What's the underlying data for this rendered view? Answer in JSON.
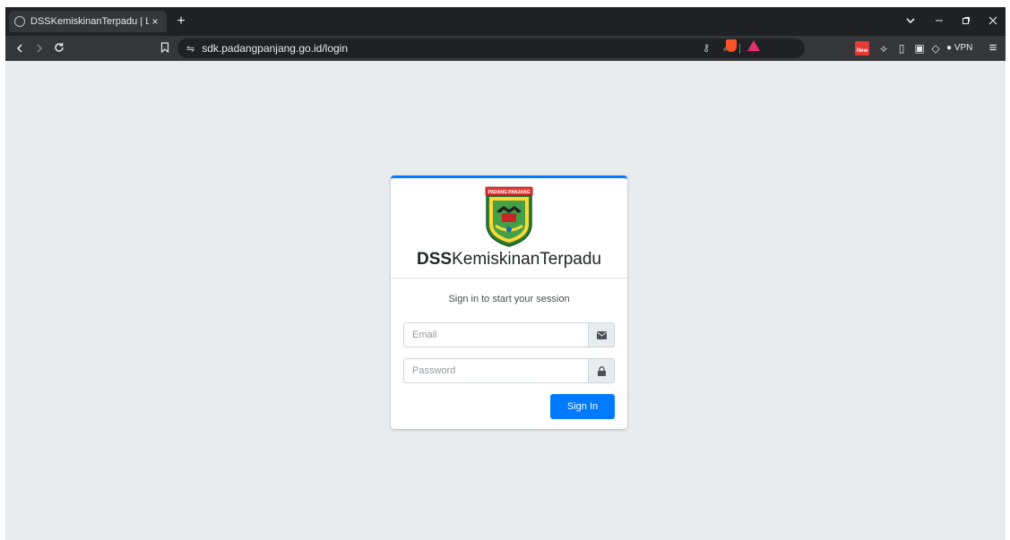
{
  "browser": {
    "tab_title": "DSSKemiskinanTerpadu | Log in",
    "tab_close": "×",
    "new_tab": "+",
    "url": "sdk.padangpanjang.go.id/login",
    "new_badge": "New",
    "vpn_label": "VPN"
  },
  "login": {
    "logo_text": "PADANG PANJANG",
    "brand_bold": "DSS",
    "brand_rest": "KemiskinanTerpadu",
    "message": "Sign in to start your session",
    "email_placeholder": "Email",
    "password_placeholder": "Password",
    "sign_in_label": "Sign In"
  },
  "colors": {
    "accent": "#007bff",
    "page_background": "#e9ecef",
    "browser_chrome": "#35363a"
  }
}
